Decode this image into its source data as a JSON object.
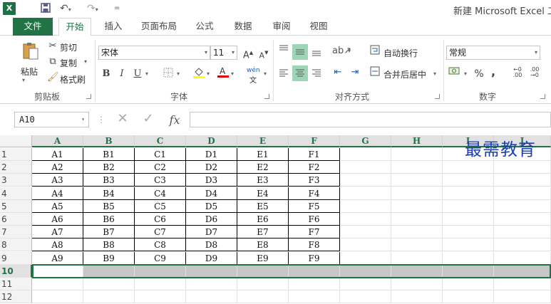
{
  "window": {
    "title": "新建 Microsoft Excel 工"
  },
  "quick_access": {
    "app_icon": "X",
    "save_icon": "save-icon",
    "undo_icon": "undo-icon",
    "redo_icon": "redo-icon"
  },
  "tabs": [
    {
      "label": "文件"
    },
    {
      "label": "开始"
    },
    {
      "label": "插入"
    },
    {
      "label": "页面布局"
    },
    {
      "label": "公式"
    },
    {
      "label": "数据"
    },
    {
      "label": "审阅"
    },
    {
      "label": "视图"
    }
  ],
  "ribbon": {
    "clipboard": {
      "paste": "粘贴",
      "cut": "剪切",
      "copy": "复制",
      "format_painter": "格式刷",
      "label": "剪贴板"
    },
    "font": {
      "name": "宋体",
      "size": "11",
      "bold": "B",
      "italic": "I",
      "underline": "U",
      "phonetic": "wén",
      "label": "字体"
    },
    "alignment": {
      "wrap": "自动换行",
      "merge": "合并后居中",
      "label": "对齐方式"
    },
    "number": {
      "format": "常规",
      "percent": "%",
      "comma": ",",
      "label": "数字"
    }
  },
  "formula_bar": {
    "name_box": "A10",
    "fx": "fx"
  },
  "columns": [
    "A",
    "B",
    "C",
    "D",
    "E",
    "F",
    "G",
    "H",
    "I",
    "J"
  ],
  "rows": [
    {
      "num": "1",
      "cells": [
        "A1",
        "B1",
        "C1",
        "D1",
        "E1",
        "F1"
      ]
    },
    {
      "num": "2",
      "cells": [
        "A2",
        "B2",
        "C2",
        "D2",
        "E2",
        "F2"
      ]
    },
    {
      "num": "3",
      "cells": [
        "A3",
        "B3",
        "C3",
        "D3",
        "E3",
        "F3"
      ]
    },
    {
      "num": "4",
      "cells": [
        "A4",
        "B4",
        "C4",
        "D4",
        "E4",
        "F4"
      ]
    },
    {
      "num": "5",
      "cells": [
        "A5",
        "B5",
        "C5",
        "D5",
        "E5",
        "F5"
      ]
    },
    {
      "num": "6",
      "cells": [
        "A6",
        "B6",
        "C6",
        "D6",
        "E6",
        "F6"
      ]
    },
    {
      "num": "7",
      "cells": [
        "A7",
        "B7",
        "C7",
        "D7",
        "E7",
        "F7"
      ]
    },
    {
      "num": "8",
      "cells": [
        "A8",
        "B8",
        "C8",
        "D8",
        "E8",
        "F8"
      ]
    },
    {
      "num": "9",
      "cells": [
        "A9",
        "B9",
        "C9",
        "D9",
        "E9",
        "F9"
      ]
    },
    {
      "num": "10",
      "cells": []
    },
    {
      "num": "11",
      "cells": []
    },
    {
      "num": "12",
      "cells": []
    }
  ],
  "watermark": "最需教育",
  "colors": {
    "accent": "#217346"
  }
}
